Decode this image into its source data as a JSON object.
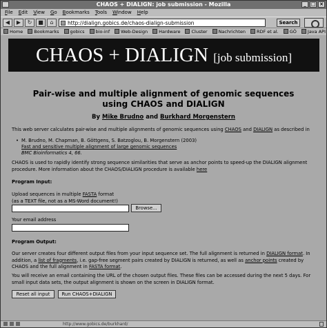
{
  "window": {
    "title": "CHAOS + DIALIGN: job submission - Mozilla"
  },
  "menu": [
    "File",
    "Edit",
    "View",
    "Go",
    "Bookmarks",
    "Tools",
    "Window",
    "Help"
  ],
  "nav": {
    "url": "http://dialign.gobics.de/chaos-dialign-submission",
    "search_label": "Search"
  },
  "bookmarks": [
    "Home",
    "Bookmarks",
    "gobics",
    "bio-inf",
    "Web-Design",
    "Hardware",
    "Cluster",
    "Nachrichten",
    "RDF et al.",
    "GÖ",
    "Java API"
  ],
  "page": {
    "banner_main": "CHAOS + DIALIGN",
    "banner_small": "[job submission]",
    "heading": "Pair-wise and multiple alignment of genomic sequences using CHAOS and DIALIGN",
    "by": "By",
    "author1": "Mike Brudno",
    "and": "and",
    "author2": "Burkhard Morgenstern",
    "intro_a": "This web server calculates pair-wise and multiple alignments of genomic sequences using",
    "intro_chaos": "CHAOS",
    "intro_and": "and",
    "intro_dialign": "DIALIGN",
    "intro_b": "as described in",
    "ref_authors": "M. Brudno, M. Chapman, B. Göttgens, S. Batzoglou, B. Morgenstern (2003)",
    "ref_title": "Fast and sensitive multiple alignment of large genomic sequences",
    "ref_journal": "BMC Bioinformatics 4, 66.",
    "chaos_desc": "CHAOS is used to rapidly identify strong sequence similarities that serve as anchor points to speed-up the DIALIGN alignment procedure. More information about the CHAOS/DIALIGN procedure is available",
    "here": "here",
    "program_input": "Program Input:",
    "upload_a": "Upload sequences in multiple",
    "upload_fasta": "FASTA",
    "upload_b": "format",
    "upload_note": "(as a TEXT file, not as a MS-Word document!)",
    "browse": "Browse...",
    "email_label": "Your email address",
    "program_output": "Program Output:",
    "out_a": "Our server creates four different output files from your input sequence set. The full alignment is returned in",
    "out_dialign_format": "DIALIGN format",
    "out_b": ". In addition, a",
    "out_fragments": "list of fragments",
    "out_c": ", i.e. gap-free segment pairs created by DIALIGN is returned, as well as",
    "out_anchor": "anchor points",
    "out_d": "created by CHAOS and the full alignment in",
    "out_fasta_format": "FASTA format",
    "out_e": ".",
    "email_note": "You will receive an email containing the URL of the chosen output files. These files can be accessed during the next 5 days. For small input data sets, the output alignment is shown on the screen in DIALIGN format.",
    "reset": "Reset all input",
    "run": "Run CHAOS+DIALIGN"
  },
  "status": {
    "text": "http://www.gobics.de/burkhard/"
  }
}
